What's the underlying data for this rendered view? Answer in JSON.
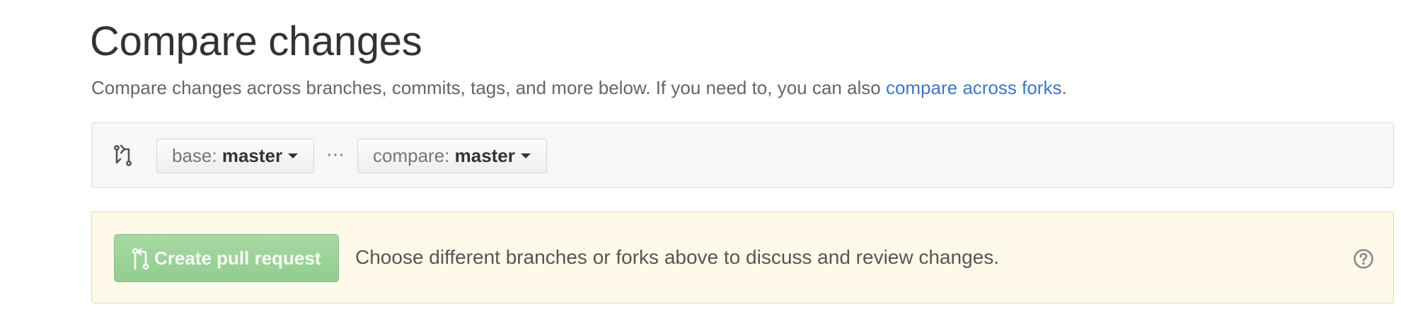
{
  "page": {
    "title": "Compare changes",
    "subtitle_prefix": "Compare changes across branches, commits, tags, and more below. If you need to, you can also ",
    "subtitle_link": "compare across forks",
    "subtitle_suffix": "."
  },
  "range": {
    "icon": "compare-arrows-icon",
    "base": {
      "prefix": "base: ",
      "value": "master"
    },
    "separator": "⋯",
    "compare": {
      "prefix": "compare: ",
      "value": "master"
    }
  },
  "notice": {
    "button_label": "Create pull request",
    "button_icon": "git-pull-request-icon",
    "message": "Choose different branches or forks above to discuss and review changes.",
    "help_icon": "question-circle-icon"
  },
  "colors": {
    "link": "#4078c0",
    "notice_bg": "#fff9ea",
    "button_green": "#9fd49b"
  }
}
